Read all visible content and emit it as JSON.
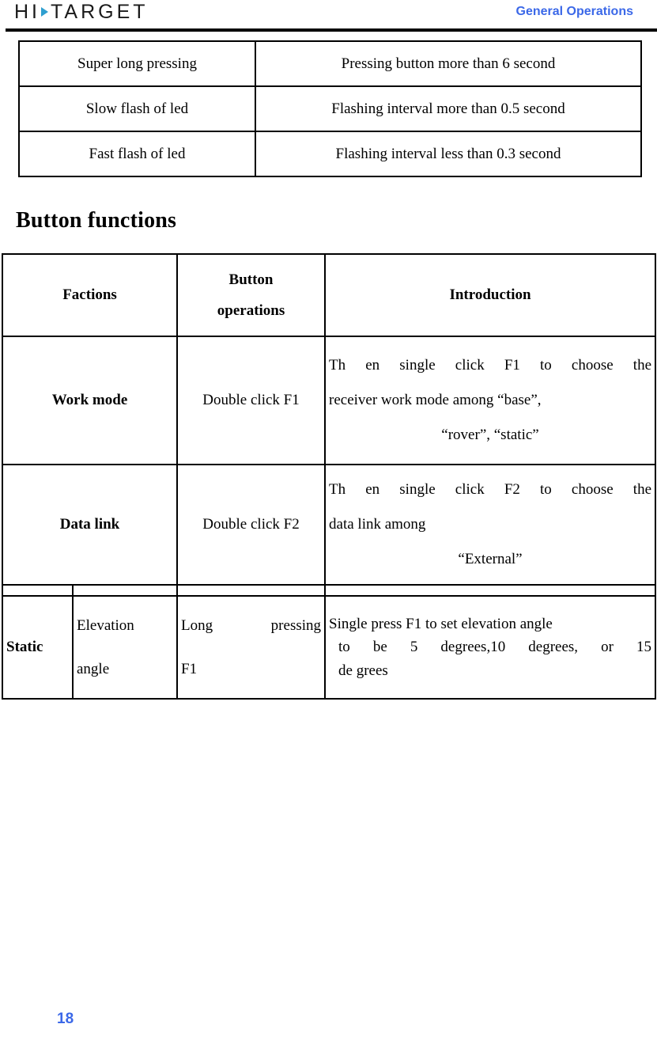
{
  "header": {
    "logo_part1": "HI",
    "logo_part2": "TARGET",
    "logo_arrow_icon": "arrow-right-icon",
    "title": "General Operations",
    "title_color": "#3b68e8",
    "arrow_color": "#2f9fd0"
  },
  "definition_table": {
    "rows": [
      {
        "term": "Super long pressing",
        "definition": "Pressing button more than 6 second"
      },
      {
        "term": "Slow flash of led",
        "definition": "Flashing interval more than 0.5 second"
      },
      {
        "term": "Fast flash of led",
        "definition": "Flashing interval less than 0.3 second"
      }
    ]
  },
  "section": {
    "heading": "Button functions"
  },
  "button_functions_table": {
    "headers": {
      "factions": "Factions",
      "button_operations_line1": "Button",
      "button_operations_line2": "operations",
      "introduction": "Introduction"
    },
    "rows": [
      {
        "faction": "Work mode",
        "operation": "Double click F1",
        "intro_line1": "Th en single click    F1 to choose          the",
        "intro_line2": "receiver work mode among “base”,",
        "intro_line3": "“rover”, “static”"
      },
      {
        "faction": "Data link",
        "operation": "Double click F2",
        "intro_line1": "Th en single click     F2 to choose     the",
        "intro_line2": "data link among",
        "intro_line3": "“External”"
      }
    ],
    "static_row": {
      "group_label": "Static",
      "sub_label_line1": "Elevation",
      "sub_label_line2": "angle",
      "operation_line1": "Long     pressing",
      "operation_line2": "F1",
      "intro_line1": "Single press F1 to set elevation angle",
      "intro_line2": "to be 5 degrees,10 degrees, or            15",
      "intro_line3": "de grees"
    }
  },
  "footer": {
    "page_number": "18",
    "page_number_color": "#3b68e8"
  }
}
